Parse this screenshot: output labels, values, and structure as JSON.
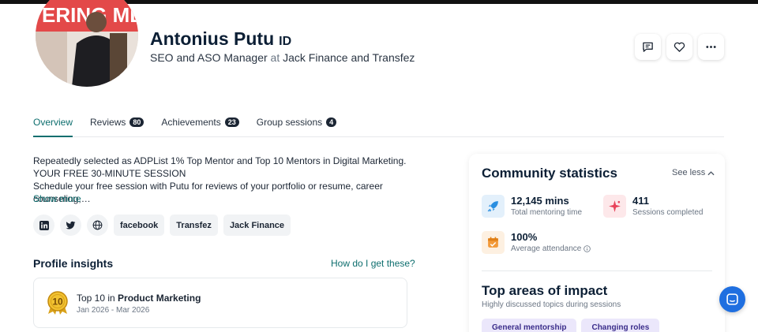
{
  "profile": {
    "name": "Antonius Putu",
    "country": "ID",
    "title": "SEO and ASO Manager",
    "at": "at",
    "company": "Jack Finance and Transfez",
    "avatar_banner_text": "ERING ME"
  },
  "actions": {
    "message_icon": "message-icon",
    "favorite_icon": "heart-icon",
    "more_icon": "more-icon"
  },
  "tabs": [
    {
      "label": "Overview",
      "count": null,
      "active": true
    },
    {
      "label": "Reviews",
      "count": "80"
    },
    {
      "label": "Achievements",
      "count": "23"
    },
    {
      "label": "Group sessions",
      "count": "4"
    }
  ],
  "bio": {
    "line1": "Repeatedly selected as ADPList 1% Top Mentor and Top 10 Mentors in Digital Marketing.",
    "line2": "YOUR FREE 30-MINUTE SESSION",
    "line3": "Schedule your free session with Putu for reviews of your portfolio or resume, career counseling,…",
    "show_more": "Show more"
  },
  "socials": {
    "icons": [
      "linkedin-icon",
      "twitter-icon",
      "globe-icon"
    ],
    "links": [
      "facebook",
      "Transfez",
      "Jack Finance"
    ]
  },
  "insights": {
    "title": "Profile insights",
    "link": "How do I get these?",
    "item": {
      "prefix": "Top 10 in",
      "category": "Product Marketing",
      "date": "Jan 2026 - Mar 2026",
      "medal_number": "10"
    }
  },
  "stats": {
    "title": "Community statistics",
    "toggle": "See less",
    "items": [
      {
        "value": "12,145 mins",
        "label": "Total mentoring time",
        "icon": "rocket-icon"
      },
      {
        "value": "411",
        "label": "Sessions completed",
        "icon": "sparkle-icon"
      },
      {
        "value": "100%",
        "label": "Average attendance",
        "icon": "calendar-icon"
      }
    ],
    "impact_title": "Top areas of impact",
    "impact_sub": "Highly discussed topics during sessions",
    "topics": [
      "General mentorship",
      "Changing roles"
    ]
  },
  "colors": {
    "accent": "#0d6e6e",
    "heading": "#0c1f35",
    "fab": "#1f6fe0",
    "topic_bg": "#ebe7fb"
  }
}
